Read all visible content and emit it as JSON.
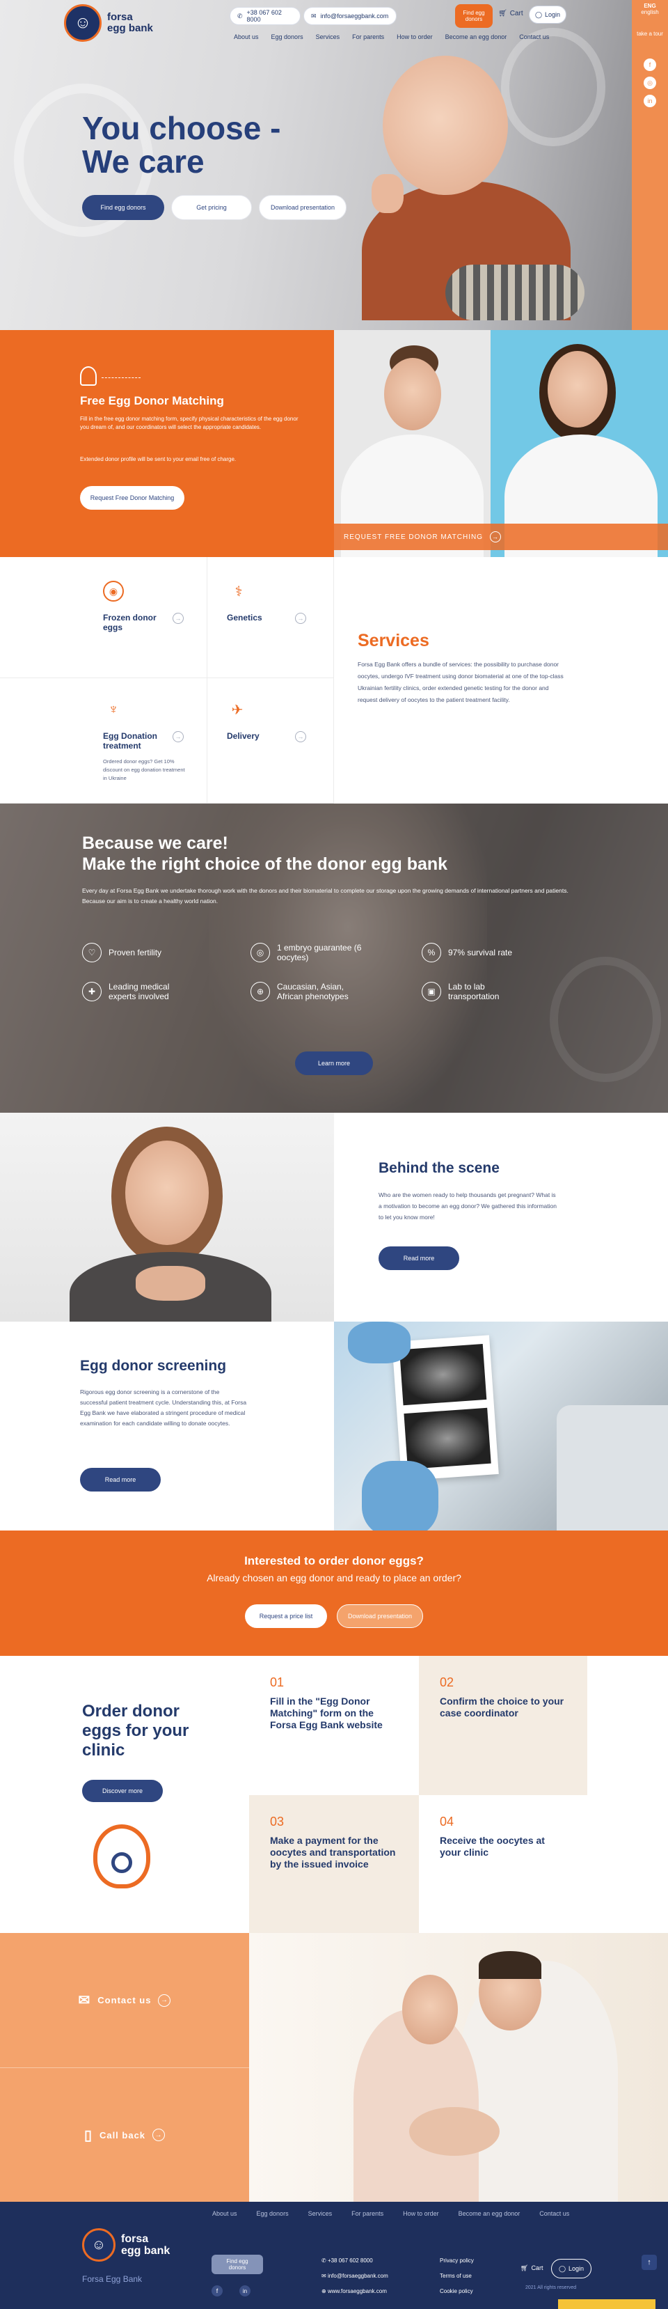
{
  "brand": {
    "name_line1": "forsa",
    "name_line2": "egg bank",
    "footer_tag": "Forsa Egg Bank"
  },
  "header": {
    "phone": "+38 067 602 8000",
    "email": "info@forsaeggbank.com",
    "find_btn": "Find egg donors",
    "cart": "Cart",
    "login": "Login",
    "nav": [
      "About us",
      "Egg donors",
      "Services",
      "For parents",
      "How to order",
      "Become an egg donor",
      "Contact us"
    ]
  },
  "rail": {
    "lang": "ENG",
    "lang_sub": "english",
    "take": "take a tour"
  },
  "hero": {
    "title_line1": "You choose -",
    "title_line2": "We care",
    "btn_find": "Find egg donors",
    "btn_pricing": "Get pricing",
    "btn_presentation": "Download presentation"
  },
  "matching": {
    "title": "Free Egg Donor Matching",
    "text1": "Fill in the free egg donor matching form, specify physical characteristics of the egg donor you dream of, and our coordinators will select the appropriate candidates.",
    "text2": "Extended donor profile will be sent to your email free of charge.",
    "btn": "Request Free Donor Matching",
    "bar": "REQUEST FREE DONOR MATCHING"
  },
  "services": {
    "items": [
      {
        "name": "Frozen donor eggs",
        "icon": "egg-icon"
      },
      {
        "name": "Genetics",
        "icon": "dna-icon"
      },
      {
        "name": "Egg Donation treatment",
        "icon": "uterus-icon",
        "note": "Ordered donor eggs? Get 10% discount on egg donation treatment in Ukraine"
      },
      {
        "name": "Delivery",
        "icon": "plane-icon"
      }
    ],
    "title": "Services",
    "text": "Forsa Egg Bank offers a bundle of services: the possibility to purchase donor oocytes, undergo IVF treatment using donor biomaterial at one of the top-class Ukrainian fertility clinics, order extended genetic testing for the donor and request delivery of oocytes to the patient treatment facility."
  },
  "care": {
    "title_line1": "Because we care!",
    "title_line2": "Make the right choice of the donor egg bank",
    "text": "Every day at Forsa Egg Bank we undertake thorough work with the donors and their biomaterial to complete our storage upon the growing demands of international partners and patients. Because our aim is to create a healthy world nation.",
    "features": [
      "Proven fertility",
      "1 embryo guarantee (6 oocytes)",
      "97% survival rate",
      "Leading medical experts involved",
      "Caucasian, Asian, African phenotypes",
      "Lab to lab transportation"
    ],
    "btn": "Learn more"
  },
  "behind": {
    "title": "Behind the scene",
    "text": "Who are the women ready to help thousands get pregnant? What is a motivation to become an egg donor? We gathered this information to let you know more!",
    "btn": "Read more"
  },
  "screening": {
    "title": "Egg donor screening",
    "text": "Rigorous egg donor screening is a cornerstone of the successful patient treatment cycle. Understanding this, at Forsa Egg Bank we have elaborated a stringent procedure of medical examination for each candidate willing to donate oocytes.",
    "btn": "Read more"
  },
  "interest": {
    "title": "Interested to order donor eggs?",
    "subtitle": "Already chosen an egg donor and ready to place an order?",
    "btn_price": "Request a price list",
    "btn_presentation": "Download presentation"
  },
  "order": {
    "title": "Order donor eggs for your clinic",
    "btn": "Discover more",
    "steps": [
      {
        "num": "01",
        "text": "Fill in the \"Egg Donor Matching\" form on the Forsa Egg Bank website"
      },
      {
        "num": "02",
        "text": "Confirm the choice to your case coordinator"
      },
      {
        "num": "03",
        "text": "Make a payment for the oocytes and transportation by the issued invoice"
      },
      {
        "num": "04",
        "text": "Receive the oocytes at your clinic"
      }
    ]
  },
  "cta": {
    "contact": "Contact us",
    "call": "Call back"
  },
  "footer": {
    "nav": [
      "About us",
      "Egg donors",
      "Services",
      "For parents",
      "How to order",
      "Become an egg donor",
      "Contact us"
    ],
    "find_btn": "Find egg donors",
    "phone": "+38 067 602 8000",
    "email": "info@forsaeggbank.com",
    "site": "www.forsaeggbank.com",
    "privacy": "Privacy policy",
    "terms": "Terms of use",
    "cookie": "Cookie policy",
    "cart": "Cart",
    "login": "Login",
    "copyright": "2021 All rights reserved"
  },
  "colors": {
    "orange": "#ec6b23",
    "navy": "#243a6b",
    "light_orange": "#f4a36c",
    "beige": "#f4ece2"
  }
}
